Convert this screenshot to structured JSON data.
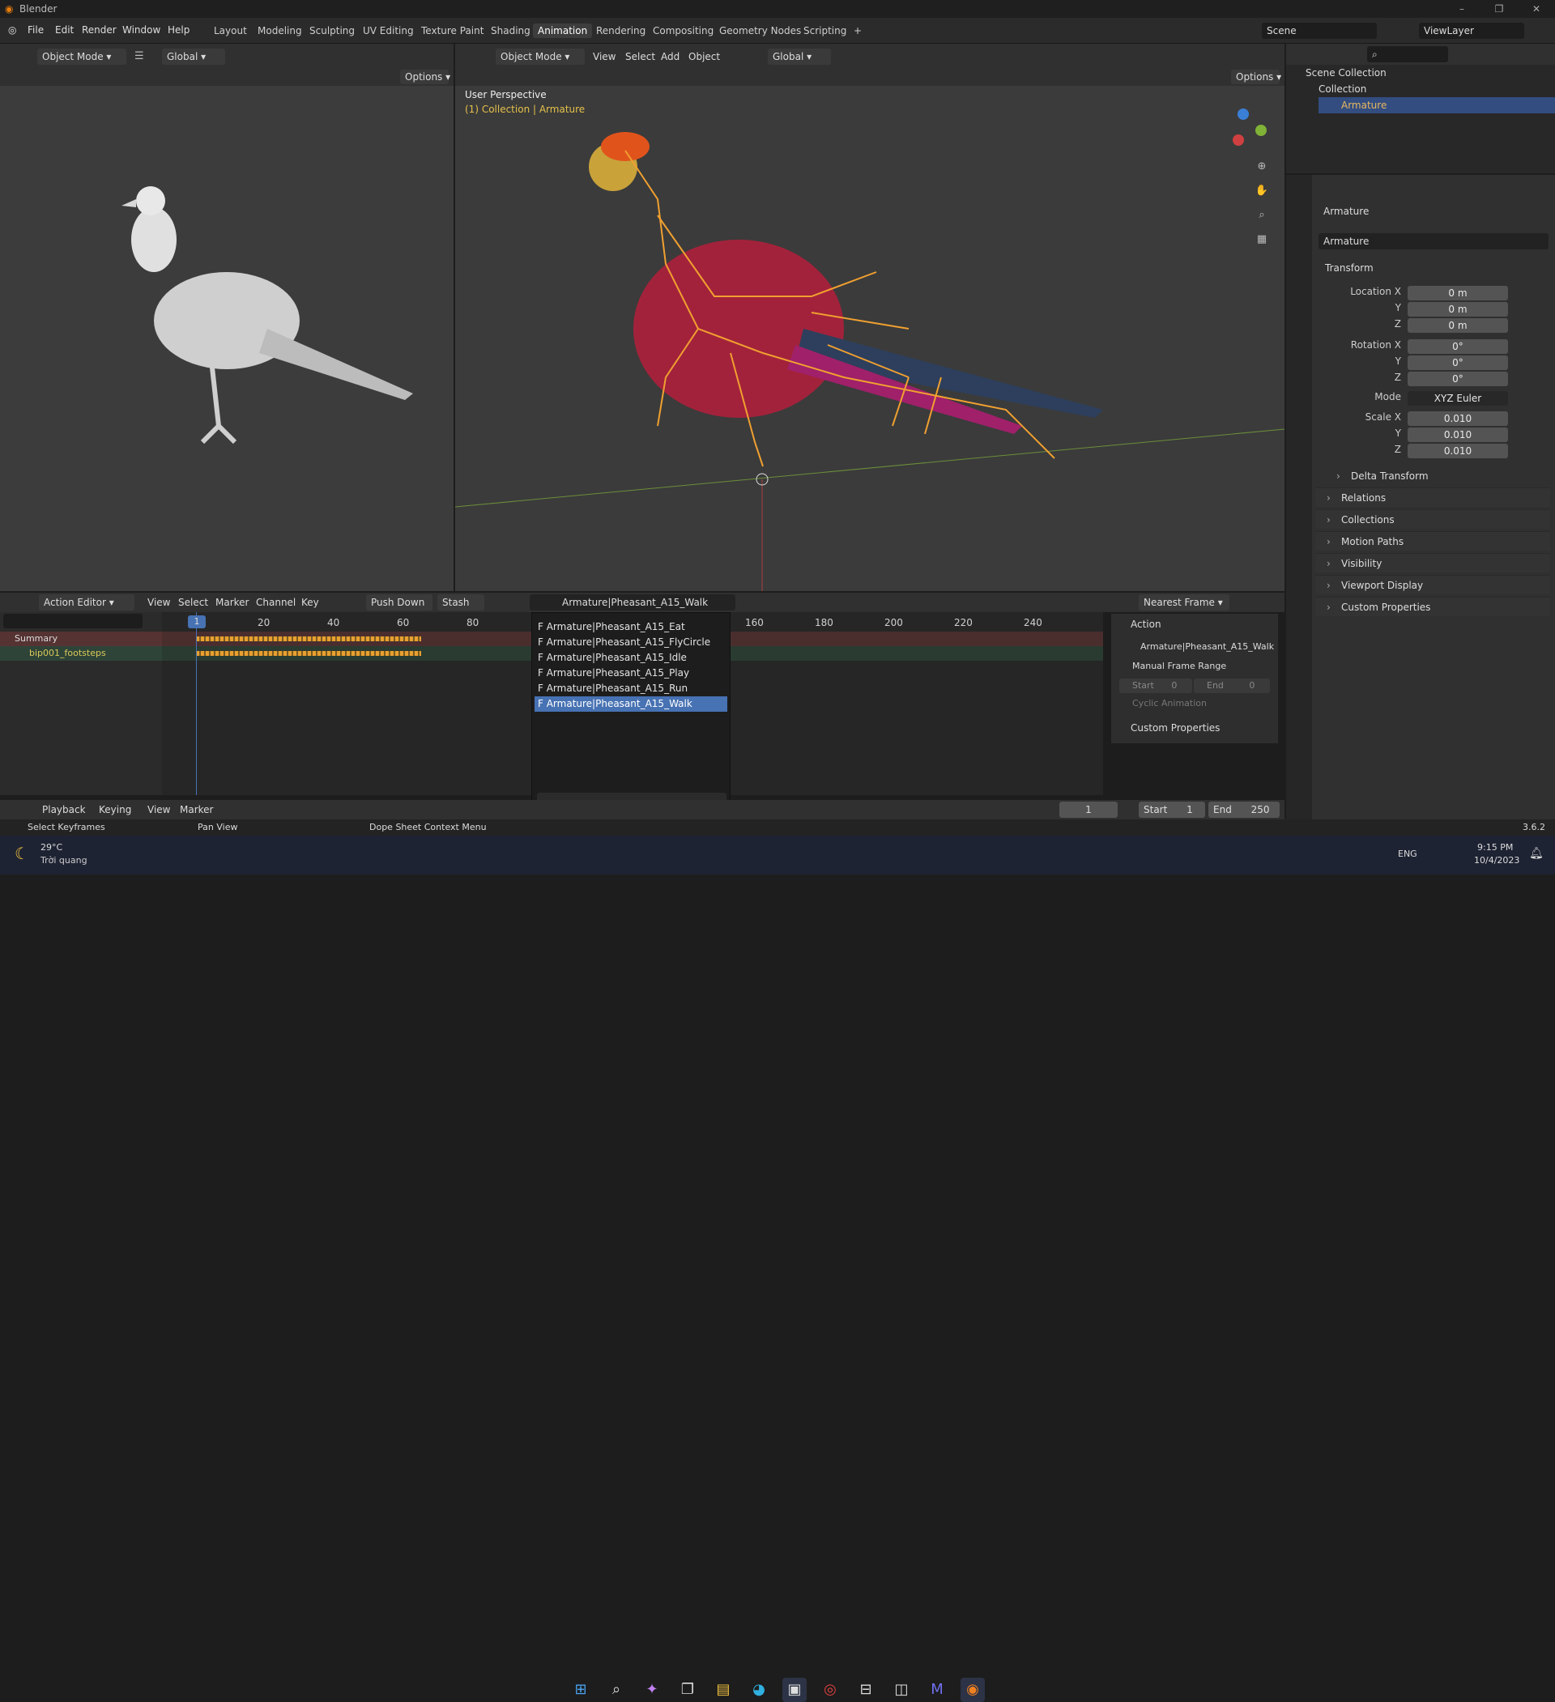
{
  "app": {
    "title": "Blender",
    "version": "3.6.2"
  },
  "menus": [
    "File",
    "Edit",
    "Render",
    "Window",
    "Help"
  ],
  "workspaces": [
    "Layout",
    "Modeling",
    "Sculpting",
    "UV Editing",
    "Texture Paint",
    "Shading",
    "Animation",
    "Rendering",
    "Compositing",
    "Geometry Nodes",
    "Scripting"
  ],
  "active_workspace": "Animation",
  "scene": {
    "name": "Scene",
    "view_layer": "ViewLayer"
  },
  "left_viewport": {
    "mode": "Object Mode",
    "orientation": "Global",
    "options": "Options"
  },
  "main_viewport": {
    "mode": "Object Mode",
    "menus": [
      "View",
      "Select",
      "Add",
      "Object"
    ],
    "orientation": "Global",
    "options": "Options",
    "info_title": "User Perspective",
    "info_sub": "(1) Collection | Armature"
  },
  "outliner": {
    "root": "Scene Collection",
    "collection": "Collection",
    "object": "Armature"
  },
  "properties": {
    "object_name": "Armature",
    "datablock": "Armature",
    "transform_label": "Transform",
    "location_label": "Location X",
    "location": [
      "0 m",
      "0 m",
      "0 m"
    ],
    "rotation_label": "Rotation X",
    "rotation": [
      "0°",
      "0°",
      "0°"
    ],
    "mode_label": "Mode",
    "mode_value": "XYZ Euler",
    "scale_label": "Scale X",
    "scale": [
      "0.010",
      "0.010",
      "0.010"
    ],
    "y": "Y",
    "z": "Z",
    "panels": [
      "Delta Transform",
      "Relations",
      "Collections",
      "Motion Paths",
      "Visibility",
      "Viewport Display",
      "Custom Properties"
    ]
  },
  "action_editor": {
    "editor": "Action Editor",
    "menus": [
      "View",
      "Select",
      "Marker",
      "Channel",
      "Key"
    ],
    "push_down": "Push Down",
    "stash": "Stash",
    "action": "Armature|Pheasant_A15_Walk",
    "snap": "Nearest Frame",
    "channels": [
      "Summary",
      "bip001_footsteps"
    ],
    "ticks": [
      "20",
      "40",
      "60",
      "80",
      "160",
      "180",
      "200",
      "220",
      "240"
    ],
    "current_frame": "1",
    "dropdown": [
      "F Armature|Pheasant_A15_Eat",
      "F Armature|Pheasant_A15_FlyCircle",
      "F Armature|Pheasant_A15_Idle",
      "F Armature|Pheasant_A15_Play",
      "F Armature|Pheasant_A15_Run",
      "F Armature|Pheasant_A15_Walk"
    ],
    "side": {
      "title": "Action",
      "action": "Armature|Pheasant_A15_Walk",
      "manual": "Manual Frame Range",
      "start": "Start",
      "start_val": "0",
      "end": "End",
      "end_val": "0",
      "cyclic": "Cyclic Animation",
      "custom": "Custom Properties"
    }
  },
  "timeline": {
    "menus": [
      "Playback",
      "Keying",
      "View",
      "Marker"
    ],
    "frame": "1",
    "start_label": "Start",
    "start": "1",
    "end_label": "End",
    "end": "250"
  },
  "status": {
    "left": "Select Keyframes",
    "mid": "Pan View",
    "right": "Dope Sheet Context Menu"
  },
  "taskbar": {
    "temp": "29°C",
    "weather": "Trời quang",
    "lang": "ENG",
    "time": "9:15 PM",
    "date": "10/4/2023"
  }
}
